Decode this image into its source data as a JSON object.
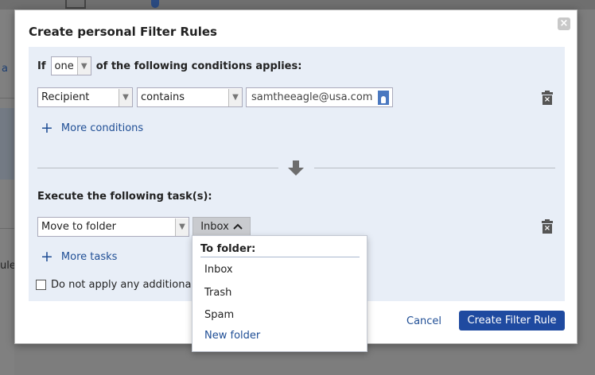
{
  "background": {
    "link_text": "a",
    "partial_text": "ule"
  },
  "dialog": {
    "title": "Create personal Filter Rules",
    "close_label": "×",
    "conditions": {
      "prefix": "If",
      "match_mode": "one",
      "suffix": "of the following conditions applies:",
      "field": "Recipient",
      "operator": "contains",
      "value": "samtheeagle@usa.com",
      "more_label": "More conditions"
    },
    "tasks": {
      "title": "Execute the following task(s):",
      "action": "Move to folder",
      "folder": "Inbox",
      "more_label": "More tasks"
    },
    "checkbox_label": "Do not apply any additional",
    "cancel_label": "Cancel",
    "submit_label": "Create Filter Rule"
  },
  "folder_popup": {
    "header": "To folder:",
    "options": [
      "Inbox",
      "Trash",
      "Spam"
    ],
    "new_folder_label": "New folder"
  },
  "colors": {
    "accent": "#1f4aa0",
    "link": "#1f4e95",
    "panel": "#e8eef7"
  },
  "icons": [
    "close-icon",
    "chevron-down-icon",
    "contact-card-icon",
    "trash-icon",
    "plus-icon",
    "arrow-down-icon",
    "chevron-up-icon"
  ]
}
